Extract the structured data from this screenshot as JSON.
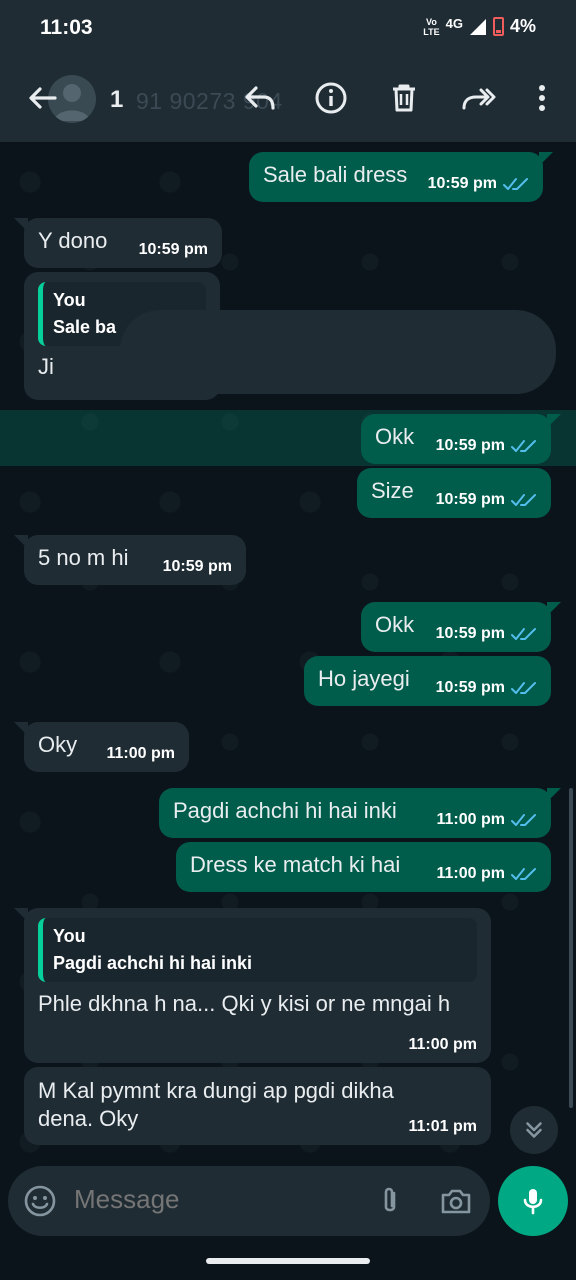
{
  "status_bar": {
    "time": "11:03",
    "volte_top": "Vo",
    "volte_bottom": "LTE",
    "network": "4G",
    "battery": "4%"
  },
  "header": {
    "contact_initial": "1",
    "contact_number": "91 90273 904",
    "icons": [
      "back-icon",
      "reply-icon",
      "info-icon",
      "delete-icon",
      "forward-icon",
      "more-vert-icon"
    ]
  },
  "messages": [
    {
      "dir": "out",
      "text": "Sale bali dress",
      "time": "10:59 pm",
      "status": "read"
    },
    {
      "dir": "in",
      "text": "Y dono",
      "time": "10:59 pm"
    },
    {
      "dir": "in",
      "quote_author": "You",
      "quote_text": "Sale ba",
      "text": "Ji",
      "time": ""
    },
    {
      "dir": "out",
      "text": "Okk",
      "time": "10:59 pm",
      "status": "read",
      "highlighted": true
    },
    {
      "dir": "out",
      "text": "Size",
      "time": "10:59 pm",
      "status": "read"
    },
    {
      "dir": "in",
      "text": "5 no m hi",
      "time": "10:59 pm"
    },
    {
      "dir": "out",
      "text": "Okk",
      "time": "10:59 pm",
      "status": "read"
    },
    {
      "dir": "out",
      "text": "Ho jayegi",
      "time": "10:59 pm",
      "status": "read"
    },
    {
      "dir": "in",
      "text": "Oky",
      "time": "11:00 pm"
    },
    {
      "dir": "out",
      "text": "Pagdi achchi hi hai inki",
      "time": "11:00 pm",
      "status": "read"
    },
    {
      "dir": "out",
      "text": "Dress ke match ki hai",
      "time": "11:00 pm",
      "status": "read"
    },
    {
      "dir": "in",
      "quote_author": "You",
      "quote_text": "Pagdi achchi hi hai inki",
      "text": "Phle dkhna h na... Qki y kisi or ne mngai h",
      "time": "11:00 pm"
    },
    {
      "dir": "in",
      "text": "M Kal pymnt kra dungi ap pgdi dikha dena. Oky",
      "time": "11:01 pm"
    }
  ],
  "composer": {
    "placeholder": "Message"
  },
  "colors": {
    "outgoing_bubble": "#005c4b",
    "incoming_bubble": "#1f2c34",
    "read_ticks": "#53bdeb",
    "accent": "#00a884",
    "chat_background": "#0b141a"
  }
}
